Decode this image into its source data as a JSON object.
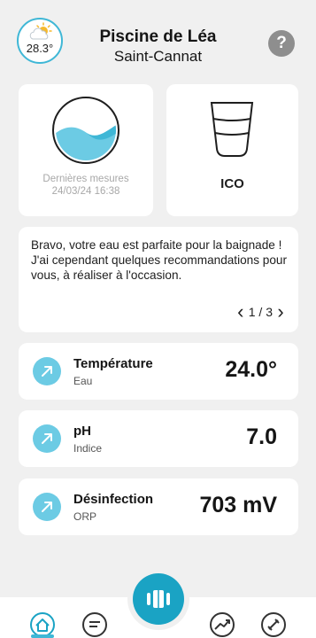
{
  "header": {
    "weather_temp": "28.3°",
    "weather_icon": "partly-sunny-icon",
    "title": "Piscine de Léa",
    "subtitle": "Saint-Cannat",
    "help_label": "?"
  },
  "measures_card": {
    "label": "Dernières mesures",
    "date": "24/03/24 16:38",
    "icon": "water-wave-icon"
  },
  "device_card": {
    "label": "ICO",
    "icon": "ico-device-icon"
  },
  "message": {
    "text": "Bravo, votre eau est parfaite pour la baignade ! J'ai cependant quelques recommandations pour vous, à réaliser à l'occasion.",
    "page": "1 / 3",
    "prev_label": "‹",
    "next_label": "›"
  },
  "metrics": [
    {
      "name": "Température",
      "sub": "Eau",
      "value": "24.0°"
    },
    {
      "name": "pH",
      "sub": "Indice",
      "value": "7.0"
    },
    {
      "name": "Désinfection",
      "sub": "ORP",
      "value": "703 mV"
    }
  ],
  "nav": {
    "items": [
      "home-icon",
      "chat-icon",
      "trend-icon",
      "tools-icon"
    ],
    "center": "pool-ladder-icon"
  },
  "colors": {
    "accent": "#3fb7d6",
    "metric_icon_bg": "#6ccbe4",
    "center_button": "#1aa3c4",
    "background": "#f0f0f0"
  }
}
